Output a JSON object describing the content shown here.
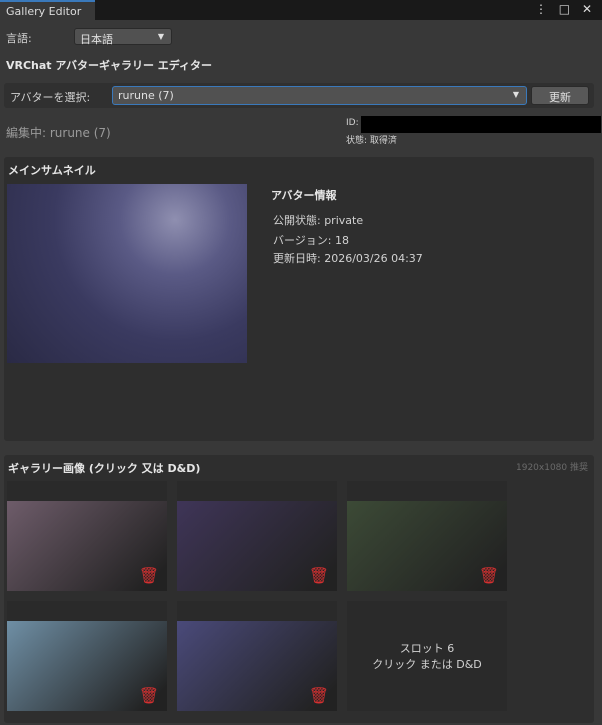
{
  "window": {
    "tab": "Gallery Editor",
    "menu_icon": "⋮",
    "maximize_icon": "□",
    "close_icon": "✕"
  },
  "language": {
    "label": "言語:",
    "value": "日本語"
  },
  "title": "VRChat アバターギャラリー エディター",
  "avatar_select": {
    "label": "アバターを選択:",
    "value": "rurune (7)",
    "refresh": "更新"
  },
  "editing": {
    "text": "編集中: rurune (7)",
    "id_label": "ID:",
    "status": "状態: 取得済"
  },
  "main_thumb": {
    "heading": "メインサムネイル",
    "info_heading": "アバター情報",
    "visibility": "公開状態: private",
    "version": "バージョン: 18",
    "updated": "更新日時: 2026/03/26 04:37"
  },
  "gallery": {
    "heading": "ギャラリー画像 (クリック 又は D&D)",
    "hint": "1920x1080 推奨",
    "empty_slot": {
      "title": "スロット 6",
      "sub": "クリック または D&D"
    },
    "colors": [
      "#6e5c6a",
      "#3f3558",
      "#3c4a36",
      "#6f8fa5",
      "#4a4a7a"
    ]
  }
}
